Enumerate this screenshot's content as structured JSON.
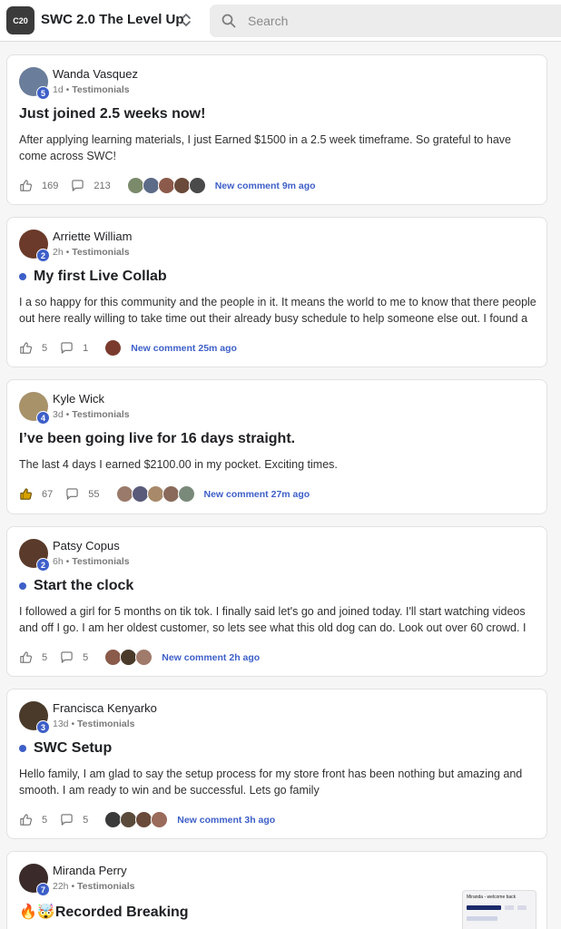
{
  "header": {
    "logo_text": "C20",
    "group_name": "SWC 2.0 The Level Up",
    "search": {
      "placeholder": "Search",
      "value": ""
    }
  },
  "colors": {
    "accent": "#3d5fc8",
    "liked": "#d6a200"
  },
  "posts": [
    {
      "author": "Wanda Vasquez",
      "level": "5",
      "time": "1d",
      "category": "Testimonials",
      "unread": false,
      "title": "Just joined 2.5 weeks now!",
      "body": "After applying learning materials, I just Earned $1500 in a 2.5 week timeframe. So grateful to have come across SWC!",
      "likes": "169",
      "comments": "213",
      "liked": false,
      "commenter_colors": [
        "#7b8a6a",
        "#5c6b87",
        "#8c5a4a",
        "#6a4a3a",
        "#4a4a4a"
      ],
      "last_comment": "New comment 9m ago"
    },
    {
      "author": "Arriette William",
      "level": "2",
      "time": "2h",
      "category": "Testimonials",
      "unread": true,
      "title": "My first Live Collab",
      "body": "I a so happy for this community and the people in it. It means the world to me to know that there people out here really willing to take time out their already busy schedule to help someone else out. I found a",
      "likes": "5",
      "comments": "1",
      "liked": false,
      "commenter_colors": [
        "#7a3b2e"
      ],
      "last_comment": "New comment 25m ago"
    },
    {
      "author": "Kyle Wick",
      "level": "4",
      "time": "3d",
      "category": "Testimonials",
      "unread": false,
      "title": "I’ve been going live for 16 days straight.",
      "body": "The last 4 days I earned $2100.00 in my pocket. Exciting times.",
      "likes": "67",
      "comments": "55",
      "liked": true,
      "commenter_colors": [
        "#9a7a6a",
        "#5a5a7a",
        "#a88a6a",
        "#8a6a5a",
        "#7a8a7a"
      ],
      "last_comment": "New comment 27m ago"
    },
    {
      "author": "Patsy Copus",
      "level": "2",
      "time": "6h",
      "category": "Testimonials",
      "unread": true,
      "title": "Start the clock",
      "body": "I followed a girl for 5 months on tik tok. I finally said let's go and joined today. I'll start watching videos and off I go. I am her oldest customer, so lets see what this old dog can do. Look out over 60 crowd. I",
      "likes": "5",
      "comments": "5",
      "liked": false,
      "commenter_colors": [
        "#8a5a4a",
        "#4a3a2a",
        "#a07a6a"
      ],
      "last_comment": "New comment 2h ago"
    },
    {
      "author": "Francisca Kenyarko",
      "level": "3",
      "time": "13d",
      "category": "Testimonials",
      "unread": true,
      "title": "SWC Setup",
      "body": "Hello family, I am glad to say the setup process for my store front has been nothing but amazing and smooth. I am ready to win and be successful. Lets go family",
      "likes": "5",
      "comments": "5",
      "liked": false,
      "commenter_colors": [
        "#3a3a3a",
        "#5a4a3a",
        "#6a4a3a",
        "#9a6a5a"
      ],
      "last_comment": "New comment 3h ago"
    },
    {
      "author": "Miranda Perry",
      "level": "7",
      "time": "22h",
      "category": "Testimonials",
      "unread": false,
      "title": "🔥🤯Recorded Breaking",
      "body": "",
      "preview_text": "Miranda - welcome back",
      "likes": "",
      "comments": "",
      "liked": false,
      "commenter_colors": [],
      "last_comment": ""
    }
  ]
}
